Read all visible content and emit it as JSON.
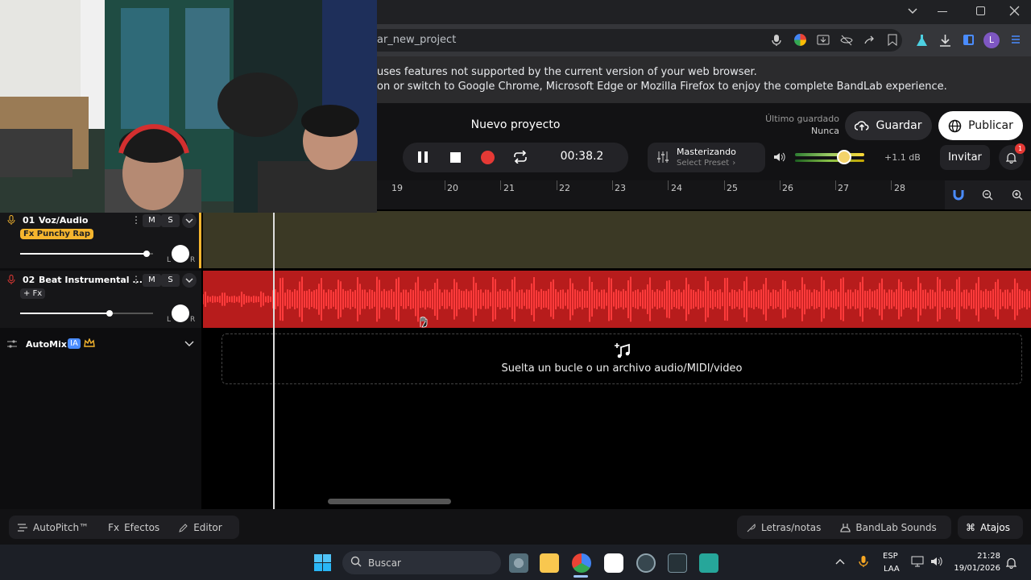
{
  "browser": {
    "url_fragment": "ar_new_project",
    "profile_initial": "L",
    "warning_line1": "uses features not supported by the current version of your web browser.",
    "warning_line2_prefix": "on or switch to ",
    "warning_line2_browsers": "Google Chrome, Microsoft Edge or Mozilla Firefox",
    "warning_line2_suffix": " to enjoy the complete BandLab experience."
  },
  "header": {
    "project_name": "Nuevo proyecto",
    "last_saved_label": "Último guardado",
    "last_saved_value": "Nunca",
    "save_label": "Guardar",
    "publish_label": "Publicar",
    "invite_label": "Invitar",
    "notifications_count": "1"
  },
  "transport": {
    "time": "00:38.2",
    "mastering_title": "Masterizando",
    "mastering_preset": "Select Preset",
    "output_db": "+1.1 dB"
  },
  "ruler": {
    "bars": [
      "19",
      "20",
      "21",
      "22",
      "23",
      "24",
      "25",
      "26",
      "27",
      "28"
    ]
  },
  "tracks": [
    {
      "number": "01",
      "name": "Voz/Audio",
      "fx": "Fx Punchy Rap",
      "mute": "M",
      "solo": "S",
      "volume": 0.95,
      "pan_left": "L",
      "pan_right": "R"
    },
    {
      "number": "02",
      "name": "Beat Instrumental ...",
      "fx": "+ Fx",
      "mute": "M",
      "solo": "S",
      "volume": 0.67,
      "pan_left": "L",
      "pan_right": "R"
    }
  ],
  "automix": {
    "label": "AutoMix",
    "badge": "IA"
  },
  "dropzone": {
    "text": "Suelta un bucle o un archivo audio/MIDI/video"
  },
  "bottom_tools": {
    "autopitch": "AutoPitch™",
    "effects_prefix": "Fx",
    "effects": "Efectos",
    "editor": "Editor",
    "lyrics": "Letras/notas",
    "sounds": "BandLab Sounds",
    "shortcuts": "Atajos"
  },
  "taskbar": {
    "search_placeholder": "Buscar",
    "lang1": "ESP",
    "lang2": "LAA",
    "time": "21:28",
    "date": "19/01/2026"
  },
  "colors": {
    "track1_region": "#3b3925",
    "track2_region": "#b71c1c",
    "accent_record": "#e53935",
    "fx_chip": "#f5b52e"
  }
}
